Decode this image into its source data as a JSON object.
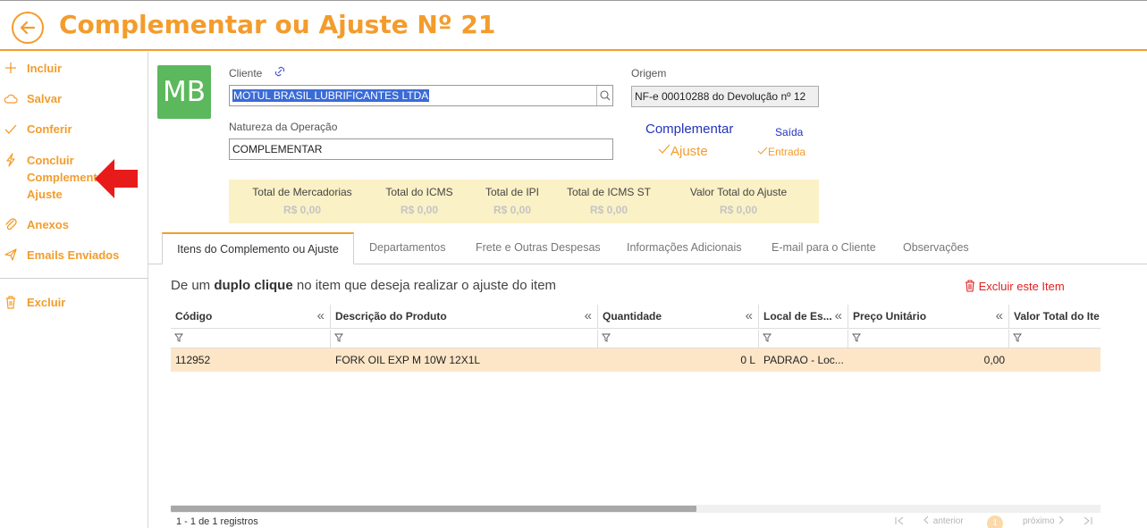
{
  "header": {
    "title": "Complementar ou Ajuste Nº 21"
  },
  "sidebar": {
    "items": [
      {
        "label": "Incluir",
        "icon": "plus-icon"
      },
      {
        "label": "Salvar",
        "icon": "cloud-icon"
      },
      {
        "label": "Conferir",
        "icon": "check-icon"
      },
      {
        "label": "Concluir Complemento ou Ajuste",
        "icon": "lightning-icon"
      },
      {
        "label": "Anexos",
        "icon": "paperclip-icon"
      },
      {
        "label": "Emails Enviados",
        "icon": "paper-plane-icon"
      },
      {
        "label": "Excluir",
        "icon": "trash-icon"
      }
    ]
  },
  "avatar": {
    "initials": "MB",
    "color": "#5cb85c"
  },
  "form": {
    "cliente_label": "Cliente",
    "cliente_value": "MOTUL BRASIL LUBRIFICANTES LTDA",
    "natureza_label": "Natureza da Operação",
    "natureza_value": "COMPLEMENTAR",
    "origem_label": "Origem",
    "origem_value": "NF-e 00010288 do Devolução nº 12"
  },
  "options": {
    "complementar": "Complementar",
    "ajuste": "Ajuste",
    "saida": "Saída",
    "entrada": "Entrada"
  },
  "totals": [
    {
      "label": "Total de Mercadorias",
      "value": "R$ 0,00"
    },
    {
      "label": "Total do ICMS",
      "value": "R$ 0,00"
    },
    {
      "label": "Total de IPI",
      "value": "R$ 0,00"
    },
    {
      "label": "Total de ICMS ST",
      "value": "R$ 0,00"
    },
    {
      "label": "Valor Total do Ajuste",
      "value": "R$ 0,00"
    }
  ],
  "tabs": [
    "Itens do Complemento ou Ajuste",
    "Departamentos",
    "Frete e Outras Despesas",
    "Informações Adicionais",
    "E-mail para o Cliente",
    "Observações"
  ],
  "hint": {
    "prefix": "De um",
    "bold": "duplo clique",
    "suffix": "no item que deseja realizar o ajuste do item"
  },
  "excluir_item": "Excluir este Item",
  "grid": {
    "columns": [
      "Código",
      "Descrição do Produto",
      "Quantidade",
      "Local de Es...",
      "Preço Unitário",
      "Valor Total do Ite"
    ],
    "rows": [
      {
        "codigo": "112952",
        "descricao": "FORK OIL EXP M 10W 12X1L",
        "quantidade": "0 L",
        "local": "PADRAO - Loc...",
        "preco": "0,00",
        "valor_total": ""
      }
    ]
  },
  "footer": {
    "count": "1 - 1 de 1 registros",
    "anterior": "anterior",
    "proximo": "próximo",
    "page": "1"
  },
  "colors": {
    "accent": "#f39c2c",
    "row_highlight": "#fde6c8",
    "totals_bg": "#fbf1c6",
    "danger": "#e02020"
  }
}
